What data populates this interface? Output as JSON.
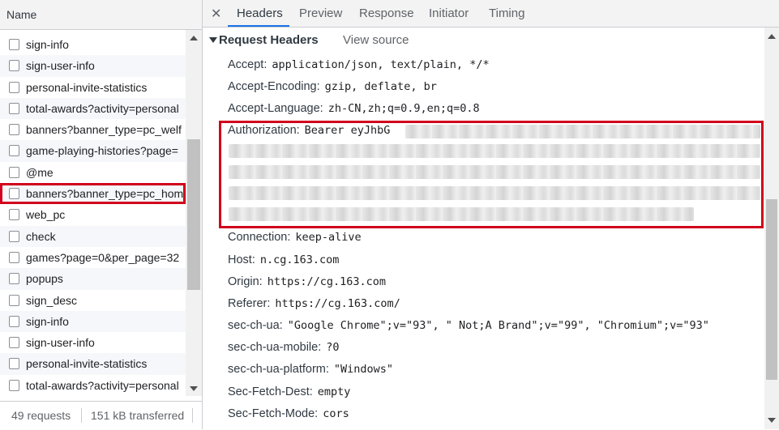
{
  "left": {
    "column_header": "Name",
    "requests": [
      "sign-info",
      "sign-user-info",
      "personal-invite-statistics",
      "total-awards?activity=personal",
      "banners?banner_type=pc_welf",
      "game-playing-histories?page=",
      "@me",
      "banners?banner_type=pc_hom",
      "web_pc",
      "check",
      "games?page=0&per_page=32",
      "popups",
      "sign_desc",
      "sign-info",
      "sign-user-info",
      "personal-invite-statistics",
      "total-awards?activity=personal"
    ],
    "status": {
      "requests": "49 requests",
      "transferred": "151 kB transferred"
    }
  },
  "tabs": [
    "Headers",
    "Preview",
    "Response",
    "Initiator",
    "Timing"
  ],
  "active_tab": "Headers",
  "section": {
    "title": "Request Headers",
    "view_source": "View source"
  },
  "headers": [
    {
      "key": "Accept:",
      "value": "application/json, text/plain, */*"
    },
    {
      "key": "Accept-Encoding:",
      "value": "gzip, deflate, br"
    },
    {
      "key": "Accept-Language:",
      "value": "zh-CN,zh;q=0.9,en;q=0.8"
    },
    {
      "key": "Authorization:",
      "value": "Bearer eyJhbG"
    },
    {
      "key": "Connection:",
      "value": "keep-alive"
    },
    {
      "key": "Host:",
      "value": "n.cg.163.com"
    },
    {
      "key": "Origin:",
      "value": "https://cg.163.com"
    },
    {
      "key": "Referer:",
      "value": "https://cg.163.com/"
    },
    {
      "key": "sec-ch-ua:",
      "value": "\"Google Chrome\";v=\"93\", \" Not;A Brand\";v=\"99\", \"Chromium\";v=\"93\""
    },
    {
      "key": "sec-ch-ua-mobile:",
      "value": "?0"
    },
    {
      "key": "sec-ch-ua-platform:",
      "value": "\"Windows\""
    },
    {
      "key": "Sec-Fetch-Dest:",
      "value": "empty"
    },
    {
      "key": "Sec-Fetch-Mode:",
      "value": "cors"
    }
  ],
  "colors": {
    "highlight": "#d1001c",
    "active_tab_underline": "#1a73e8"
  },
  "icons": {
    "close": "close-icon",
    "expand": "triangle-down-icon"
  }
}
